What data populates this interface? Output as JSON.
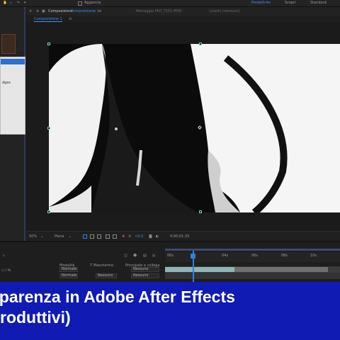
{
  "topbar": {
    "left_label": "Aggancia",
    "workspace_items": [
      "Predefinito",
      "Scopri",
      "Standard"
    ]
  },
  "comp_tabs": {
    "panel_prefix": "Composizione",
    "active_tab": "Composizione 1",
    "footage_tab": "Metraggio MVI_7101.MOV",
    "layer_tab": "Livello (nessuno)",
    "sub_tab": "Composizione 1"
  },
  "left_panel": {
    "menu_partial_text": "dges"
  },
  "viewer_bar": {
    "zoom": "50%",
    "resolution": "Piena",
    "exposure": "+0,0",
    "timecode": "0:00:01:25"
  },
  "timeline": {
    "ruler_ticks": [
      "00s",
      "04s",
      "06s",
      "08s",
      "10s"
    ],
    "column_headers": {
      "mode": "Modalità",
      "track_matte": "T  Mascherino",
      "parent": "Principale e collega"
    },
    "rows": [
      {
        "mode": "Normale",
        "matte": "",
        "parent": "Nessuno"
      },
      {
        "mode": "Normale",
        "matte": "Nessuno",
        "parent": "Nessuno"
      }
    ]
  },
  "banner": {
    "line1": "sparenza in Adobe After Effects",
    "line2": "roduttivi)"
  },
  "colors": {
    "accent_blue": "#2f7fe0",
    "banner_bg": "#0f1bb3",
    "clip_teal": "#8fb5b5"
  }
}
